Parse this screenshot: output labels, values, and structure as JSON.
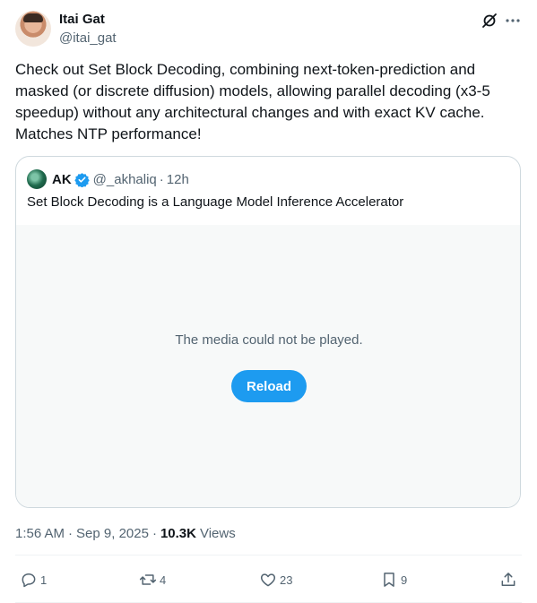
{
  "author": {
    "name": "Itai Gat",
    "handle": "@itai_gat"
  },
  "tweet_text": "Check out Set Block Decoding, combining next-token-prediction and masked (or discrete diffusion) models, allowing parallel decoding (x3-5 speedup) without any architectural changes and with exact KV cache. Matches NTP performance!",
  "quote": {
    "name": "AK",
    "handle": "@_akhaliq",
    "dot": "·",
    "time": "12h",
    "text": "Set Block Decoding is a Language Model Inference Accelerator",
    "media_error": "The media could not be played.",
    "reload_label": "Reload"
  },
  "meta": {
    "time": "1:56 AM",
    "sep1": "·",
    "date": "Sep 9, 2025",
    "sep2": "·",
    "views_count": "10.3K",
    "views_label": "Views"
  },
  "actions": {
    "replies": "1",
    "reposts": "4",
    "likes": "23",
    "bookmarks": "9"
  },
  "colors": {
    "accent": "#1d9bf0",
    "text_primary": "#0f1419",
    "text_secondary": "#536471",
    "border": "#cfd9de"
  },
  "icons": [
    "grok-icon",
    "more-icon",
    "verified-icon",
    "reply-icon",
    "retweet-icon",
    "like-icon",
    "bookmark-icon",
    "share-icon"
  ]
}
